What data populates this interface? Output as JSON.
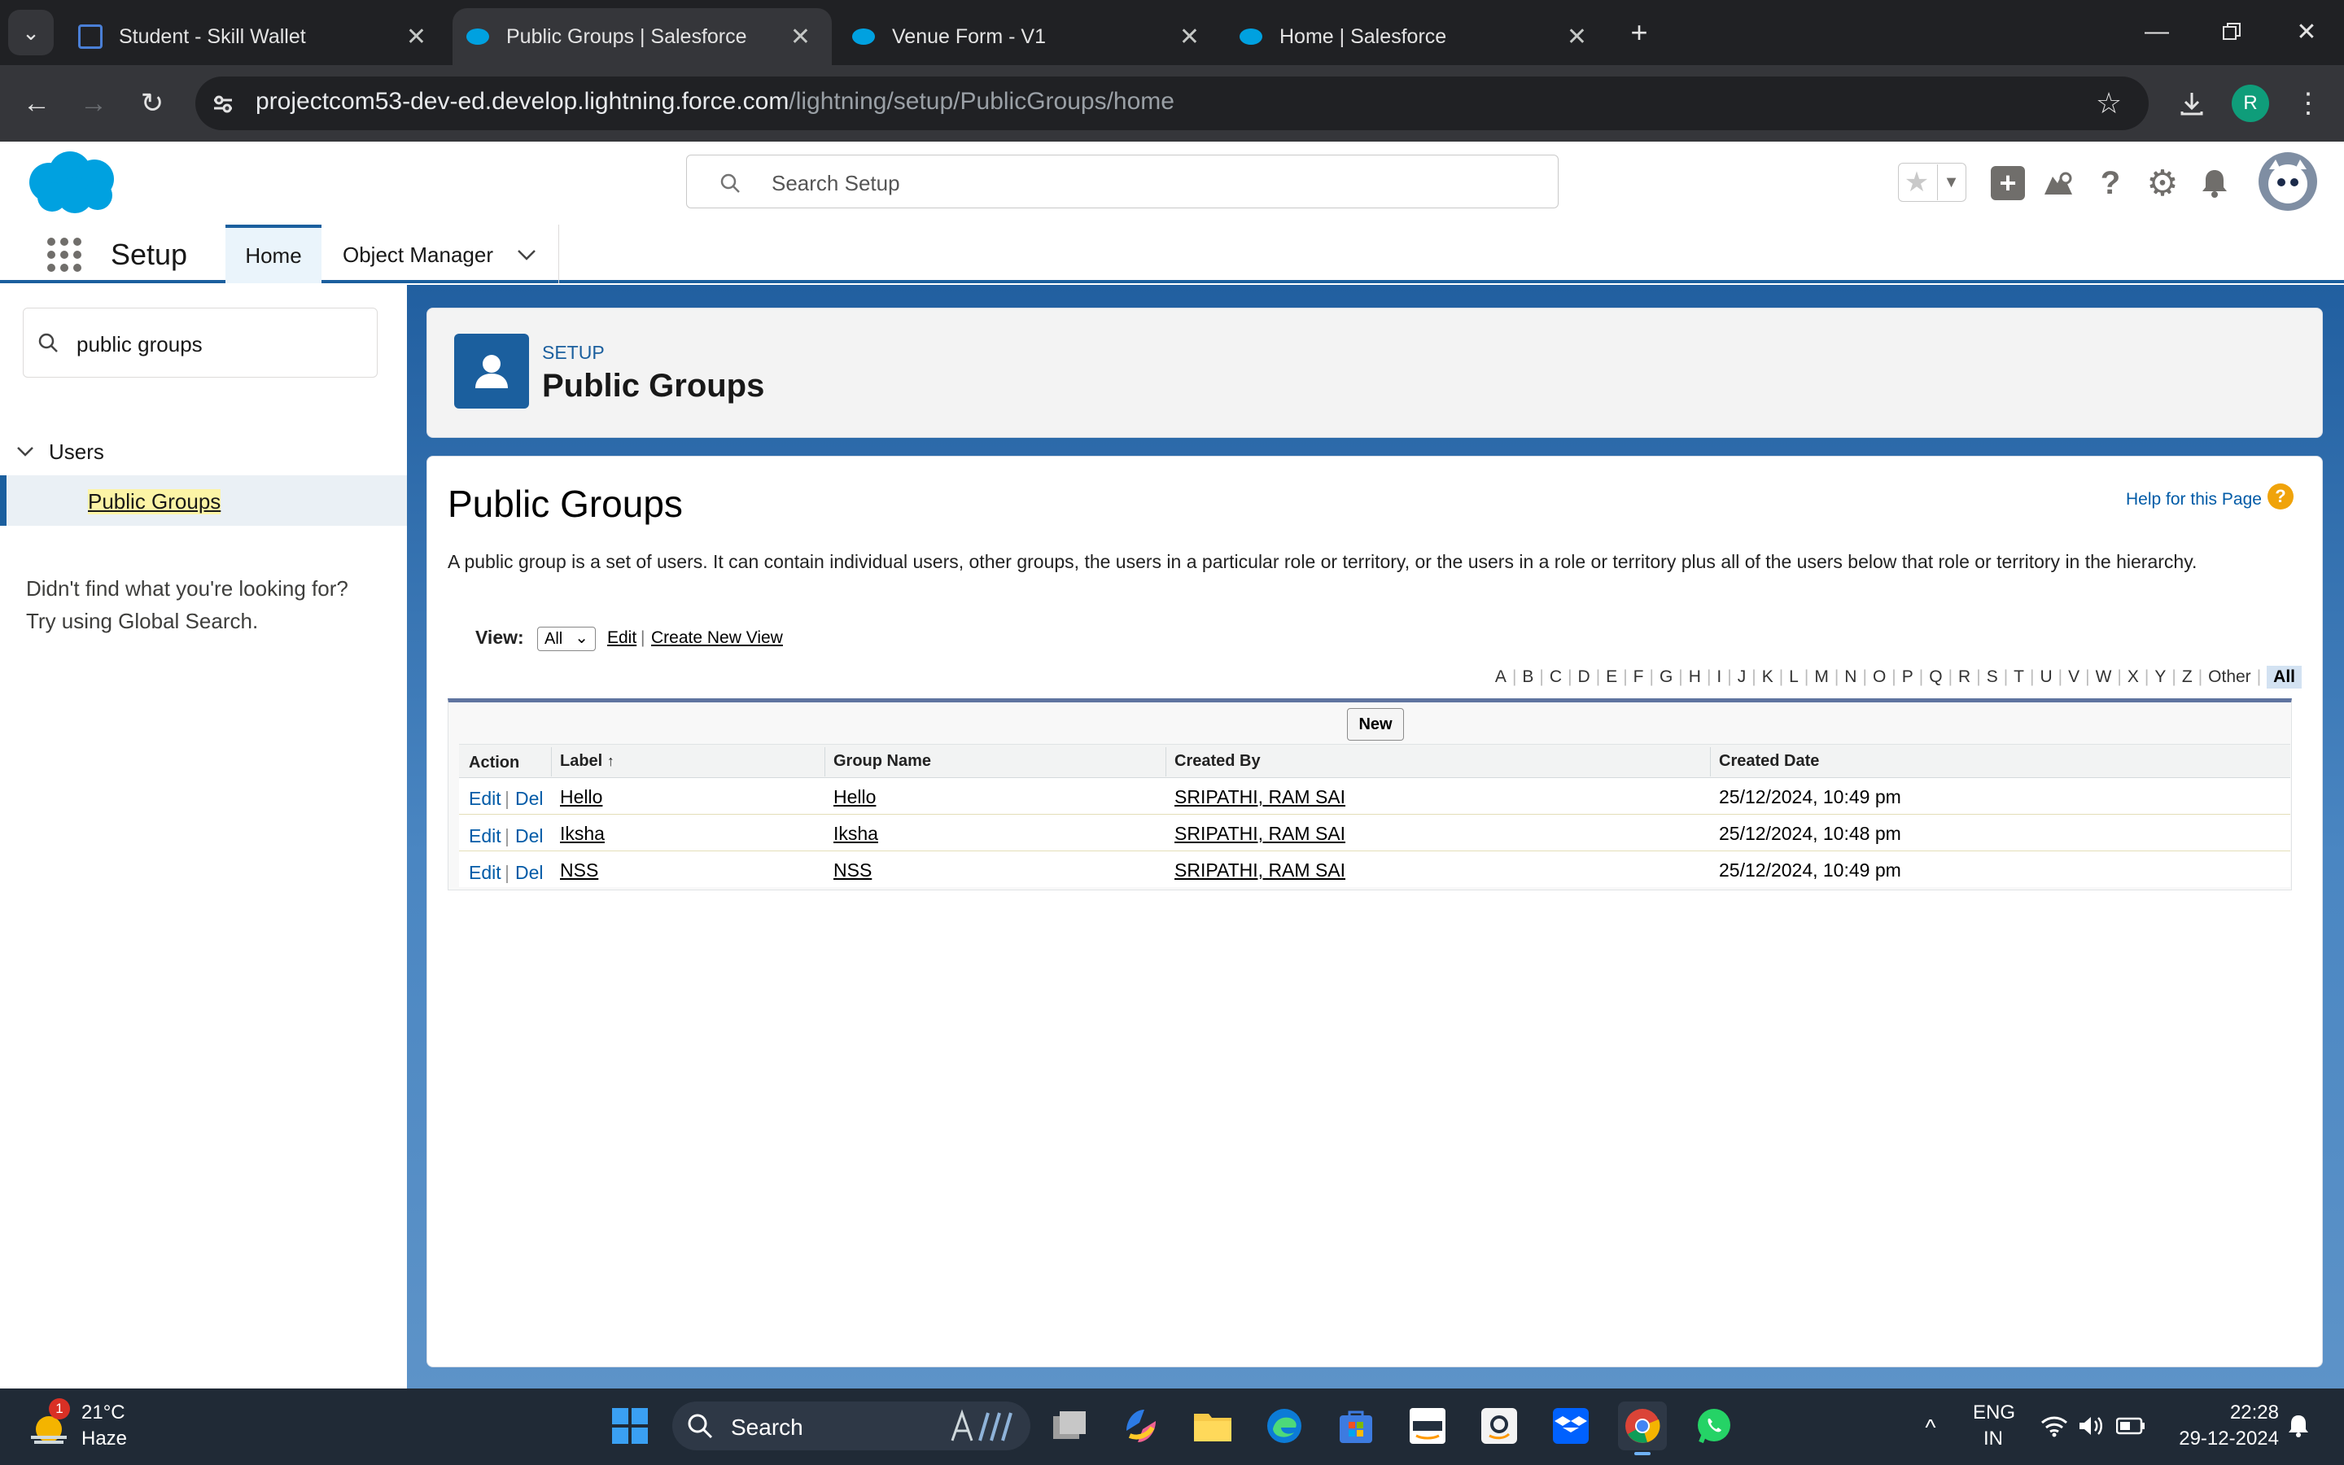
{
  "browser": {
    "tabs": [
      {
        "title": "Student - Skill Wallet"
      },
      {
        "title": "Public Groups | Salesforce"
      },
      {
        "title": "Venue Form - V1"
      },
      {
        "title": "Home | Salesforce"
      }
    ],
    "url_host": "projectcom53-dev-ed.develop.lightning.force.com",
    "url_path": "/lightning/setup/PublicGroups/home",
    "profile_initial": "R"
  },
  "sf": {
    "search_placeholder": "Search Setup",
    "app_name": "Setup",
    "nav": [
      "Home",
      "Object Manager"
    ]
  },
  "sidebar": {
    "search_value": "public groups",
    "section": "Users",
    "item": "Public Groups",
    "help_line1": "Didn't find what you're looking for?",
    "help_line2": "Try using Global Search."
  },
  "header": {
    "eyebrow": "SETUP",
    "title": "Public Groups"
  },
  "main": {
    "title": "Public Groups",
    "help_link": "Help for this Page",
    "description": "A public group is a set of users. It can contain individual users, other groups, the users in a particular role or territory, or the users in a role or territory plus all of the users below that role or territory in the hierarchy.",
    "view_label": "View:",
    "view_value": "All",
    "edit_link": "Edit",
    "create_view_link": "Create New View",
    "alpha": [
      "A",
      "B",
      "C",
      "D",
      "E",
      "F",
      "G",
      "H",
      "I",
      "J",
      "K",
      "L",
      "M",
      "N",
      "O",
      "P",
      "Q",
      "R",
      "S",
      "T",
      "U",
      "V",
      "W",
      "X",
      "Y",
      "Z",
      "Other",
      "All"
    ],
    "new_button": "New",
    "columns": [
      "Action",
      "Label",
      "Group Name",
      "Created By",
      "Created Date"
    ],
    "action_edit": "Edit",
    "action_del": "Del",
    "rows": [
      {
        "label": "Hello",
        "group_name": "Hello",
        "created_by": "SRIPATHI, RAM SAI",
        "created_date": "25/12/2024, 10:49 pm"
      },
      {
        "label": "Iksha",
        "group_name": "Iksha",
        "created_by": "SRIPATHI, RAM SAI",
        "created_date": "25/12/2024, 10:48 pm"
      },
      {
        "label": "NSS",
        "group_name": "NSS",
        "created_by": "SRIPATHI, RAM SAI",
        "created_date": "25/12/2024, 10:49 pm"
      }
    ]
  },
  "taskbar": {
    "weather_temp": "21°C",
    "weather_desc": "Haze",
    "weather_badge": "1",
    "search_label": "Search",
    "lang1": "ENG",
    "lang2": "IN",
    "time": "22:28",
    "date": "29-12-2024"
  },
  "colors": {
    "brand": "#0176d3",
    "setup_blue": "#1b5f9e",
    "chrome_dark": "#202124"
  }
}
